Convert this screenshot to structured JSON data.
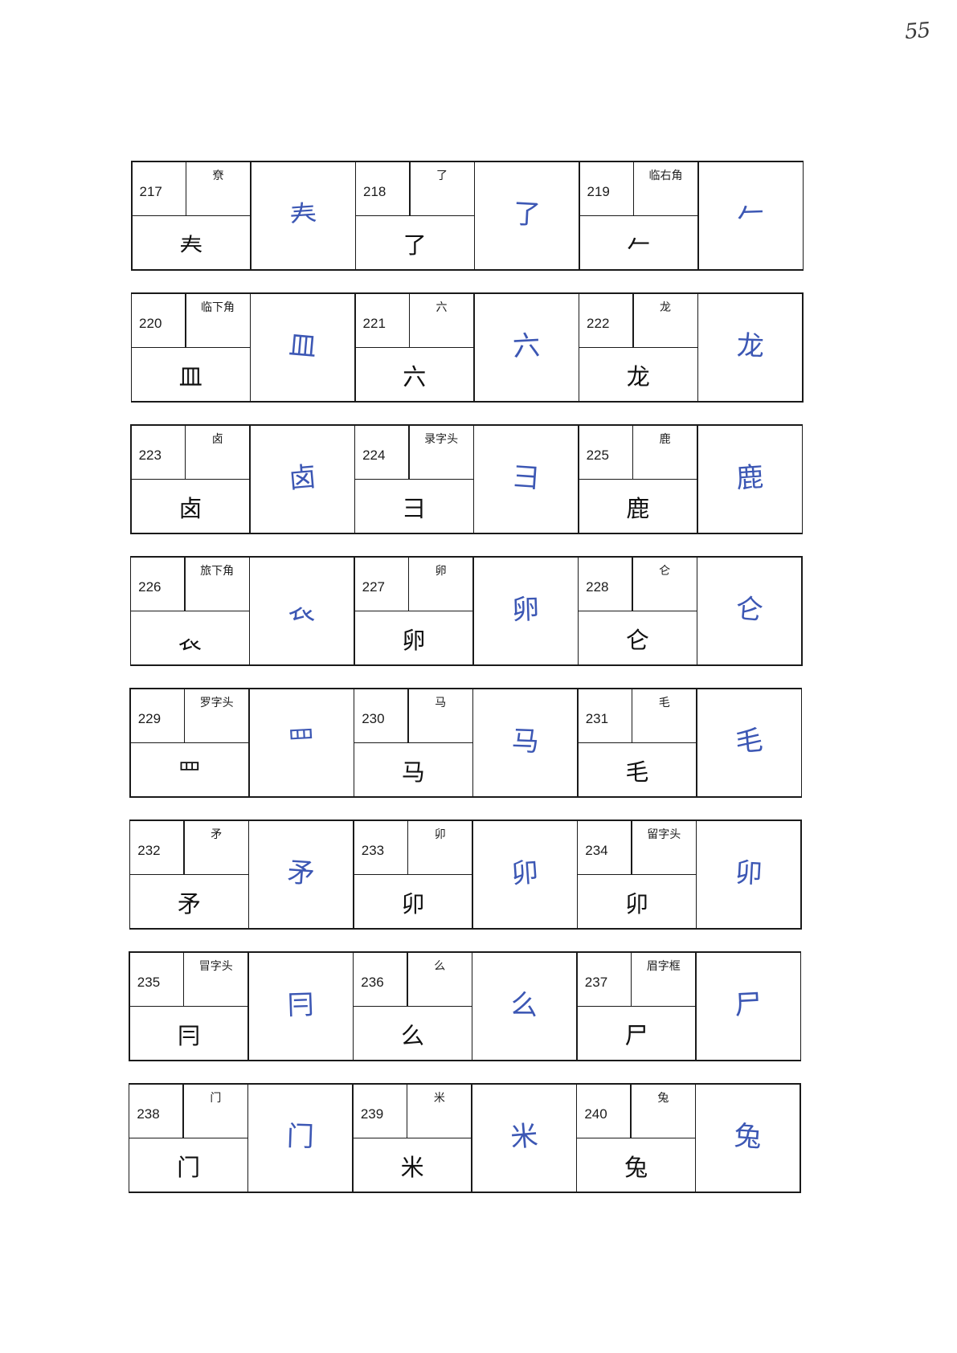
{
  "page_number": "55",
  "colors": {
    "ink": "#3c57b4",
    "line": "#1a1a1a"
  },
  "entries": [
    {
      "num": "217",
      "label": "尞",
      "printed": "𡗗",
      "handwritten": "𡗗"
    },
    {
      "num": "218",
      "label": "了",
      "printed": "了",
      "handwritten": "了"
    },
    {
      "num": "219",
      "label": "临右角",
      "printed": "𠂉",
      "handwritten": "𠂉"
    },
    {
      "num": "220",
      "label": "临下角",
      "printed": "皿",
      "handwritten": "皿"
    },
    {
      "num": "221",
      "label": "六",
      "printed": "六",
      "handwritten": "六"
    },
    {
      "num": "222",
      "label": "龙",
      "printed": "龙",
      "handwritten": "龙"
    },
    {
      "num": "223",
      "label": "卤",
      "printed": "卤",
      "handwritten": "卤"
    },
    {
      "num": "224",
      "label": "录字头",
      "printed": "彐",
      "handwritten": "彐"
    },
    {
      "num": "225",
      "label": "鹿",
      "printed": "鹿",
      "handwritten": "鹿"
    },
    {
      "num": "226",
      "label": "旅下角",
      "printed": "𧘇",
      "handwritten": "𧘇"
    },
    {
      "num": "227",
      "label": "卵",
      "printed": "卵",
      "handwritten": "卵"
    },
    {
      "num": "228",
      "label": "仑",
      "printed": "仑",
      "handwritten": "仑"
    },
    {
      "num": "229",
      "label": "罗字头",
      "printed": "罒",
      "handwritten": "罒"
    },
    {
      "num": "230",
      "label": "马",
      "printed": "马",
      "handwritten": "马"
    },
    {
      "num": "231",
      "label": "毛",
      "printed": "毛",
      "handwritten": "毛"
    },
    {
      "num": "232",
      "label": "矛",
      "printed": "矛",
      "handwritten": "矛"
    },
    {
      "num": "233",
      "label": "卯",
      "printed": "卯",
      "handwritten": "卯"
    },
    {
      "num": "234",
      "label": "留字头",
      "printed": "卯",
      "handwritten": "卯"
    },
    {
      "num": "235",
      "label": "冒字头",
      "printed": "冃",
      "handwritten": "冃"
    },
    {
      "num": "236",
      "label": "么",
      "printed": "么",
      "handwritten": "么"
    },
    {
      "num": "237",
      "label": "眉字框",
      "printed": "尸",
      "handwritten": "尸"
    },
    {
      "num": "238",
      "label": "门",
      "printed": "门",
      "handwritten": "门"
    },
    {
      "num": "239",
      "label": "米",
      "printed": "米",
      "handwritten": "米"
    },
    {
      "num": "240",
      "label": "兔",
      "printed": "兔",
      "handwritten": "兔"
    }
  ]
}
